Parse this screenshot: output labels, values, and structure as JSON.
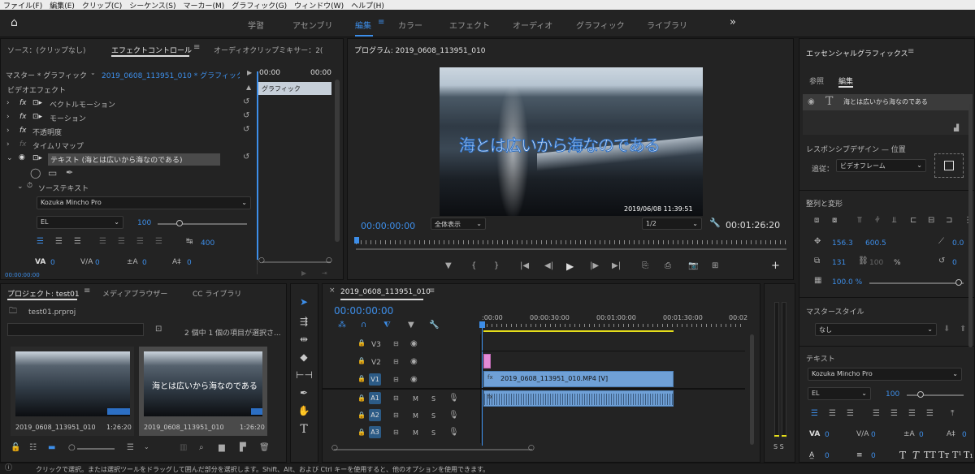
{
  "menu": [
    "ファイル(F)",
    "編集(E)",
    "クリップ(C)",
    "シーケンス(S)",
    "マーカー(M)",
    "グラフィック(G)",
    "ウィンドウ(W)",
    "ヘルプ(H)"
  ],
  "workspaces": [
    "学習",
    "アセンブリ",
    "編集",
    "カラー",
    "エフェクト",
    "オーディオ",
    "グラフィック",
    "ライブラリ"
  ],
  "workspaces_more": "»",
  "effect_controls": {
    "tabs": [
      "ソース：(クリップなし)",
      "エフェクトコントロール",
      "オーディオクリップミキサー：2("
    ],
    "master": "マスター * グラフィック",
    "sequence_clip": "2019_0608_113951_010 * グラフィック",
    "time_start": "00:00",
    "time_end": "00:00",
    "video_effects": "ビデオエフェクト",
    "items": [
      "ベクトルモーション",
      "モーション",
      "不透明度",
      "タイムリマップ"
    ],
    "text_layer": "テキスト (海とは広いから海なのである)",
    "source_text": "ソーステキスト",
    "font": "Kozuka Mincho Pro",
    "weight": "EL",
    "size": "100",
    "tracking": "400",
    "kerning": "0",
    "va2": "0",
    "baseline": "0",
    "tsume": "0",
    "graphic_clip": "グラフィック",
    "timecode": "00:00:00:00"
  },
  "program": {
    "title": "プログラム: 2019_0608_113951_010",
    "overlay_text": "海とは広いから海なのである",
    "date_stamp": "2019/06/08 11:39:51",
    "timecode": "00:00:00:00",
    "zoom": "全体表示",
    "resolution": "1/2",
    "duration": "00:01:26:20",
    "transport": [
      "▼",
      "{",
      "}",
      "|◀",
      "◀|",
      "▶",
      "|▶",
      "▶|",
      "⎘",
      "⎙",
      "📷",
      "⊞",
      "+"
    ]
  },
  "project": {
    "tabs": [
      "プロジェクト: test01",
      "メディアブラウザー",
      "CC ライブラリ"
    ],
    "file": "test01.prproj",
    "status": "2 個中 1 個の項目が選択さ...",
    "clips": [
      {
        "name": "2019_0608_113951_010",
        "duration": "1:26:20"
      },
      {
        "name": "2019_0608_113951_010",
        "duration": "1:26:20"
      }
    ],
    "thumb_overlay": "海とは広いから海なのである"
  },
  "timeline": {
    "title": "2019_0608_113951_010",
    "timecode": "00:00:00:00",
    "ruler": [
      ":00:00",
      "00:00:30:00",
      "00:01:00:00",
      "00:01:30:00",
      "00:02"
    ],
    "video_tracks": [
      "V3",
      "V2",
      "V1"
    ],
    "audio_tracks": [
      "A1",
      "A2",
      "A3"
    ],
    "clip_v1": "2019_0608_113951_010.MP4 [V]",
    "track_letters": {
      "m": "M",
      "s": "S"
    },
    "audio_meter": "S S"
  },
  "essential_graphics": {
    "title": "エッセンシャルグラフィックス",
    "tabs": [
      "参照",
      "編集"
    ],
    "layer": "海とは広いから海なのである",
    "responsive": "レスポンシブデザイン — 位置",
    "follow_label": "追従：",
    "follow_value": "ビデオフレーム",
    "align_transform": "整列と変形",
    "pos_x": "156.3",
    "pos_y": "600.5",
    "anchor_x": "0.0",
    "scale": "131",
    "scale_unit": "100",
    "percent": "%",
    "rotation": "0",
    "opacity": "100.0 %",
    "master_styles": "マスタースタイル",
    "style_value": "なし",
    "text": "テキスト",
    "font": "Kozuka Mincho Pro",
    "weight": "EL",
    "size": "100",
    "va": "0",
    "va2": "0",
    "tracking": "0",
    "tsume": "0",
    "lead": "0",
    "lead2": "0",
    "caps": [
      "T",
      "T",
      "TT",
      "Tт",
      "T¹",
      "T₁"
    ]
  },
  "status_bar": "クリックで選択。または選択ツールをドラッグして囲んだ部分を選択します。Shift、Alt、および Ctrl キーを使用すると、他のオプションを使用できます。",
  "colors": {
    "accent": "#3d8ee9",
    "panel": "#232323",
    "track_clip": "#6fa0d6",
    "audio_clip": "#6fa0d6"
  }
}
